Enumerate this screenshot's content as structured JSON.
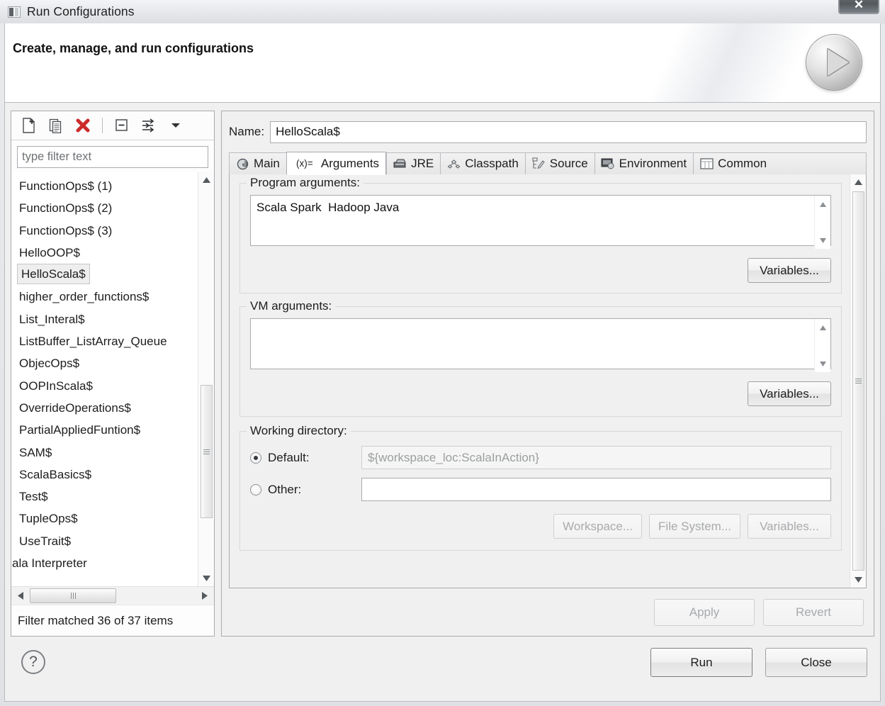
{
  "window": {
    "title": "Run Configurations",
    "icon": "run-configurations-icon",
    "close_label": "✕"
  },
  "header": {
    "title": "Create, manage, and run configurations",
    "run_icon": "play-circle-icon"
  },
  "left_panel": {
    "toolbar": [
      {
        "name": "new-configuration-icon",
        "tooltip": "New launch configuration"
      },
      {
        "name": "duplicate-configuration-icon",
        "tooltip": "Duplicate"
      },
      {
        "name": "delete-configuration-icon",
        "tooltip": "Delete"
      },
      {
        "name": "collapse-all-icon",
        "tooltip": "Collapse All"
      },
      {
        "name": "filter-icon",
        "tooltip": "Filter"
      },
      {
        "name": "chevron-down-icon",
        "tooltip": "View Menu"
      }
    ],
    "filter": {
      "placeholder": "type filter text",
      "value": ""
    },
    "items": [
      "FunctionOps$ (1)",
      "FunctionOps$ (2)",
      "FunctionOps$ (3)",
      "HelloOOP$",
      "HelloScala$",
      "higher_order_functions$",
      "List_Interal$",
      "ListBuffer_ListArray_Queue",
      "ObjecOps$",
      "OOPInScala$",
      "OverrideOperations$",
      "PartialAppliedFuntion$",
      "SAM$",
      "ScalaBasics$",
      "Test$",
      "TupleOps$",
      "UseTrait$",
      "ala Interpreter"
    ],
    "selected_item": "HelloScala$",
    "status": "Filter matched 36 of 37 items"
  },
  "right_panel": {
    "name_label": "Name:",
    "name_value": "HelloScala$",
    "tabs": [
      {
        "label": "Main",
        "icon": "main-circle-icon",
        "active": false
      },
      {
        "label": "Arguments",
        "icon": "arguments-xeq-icon",
        "active": true
      },
      {
        "label": "JRE",
        "icon": "jre-icon",
        "active": false
      },
      {
        "label": "Classpath",
        "icon": "classpath-icon",
        "active": false
      },
      {
        "label": "Source",
        "icon": "source-icon",
        "active": false
      },
      {
        "label": "Environment",
        "icon": "environment-icon",
        "active": false
      },
      {
        "label": "Common",
        "icon": "common-table-icon",
        "active": false
      }
    ],
    "program_arguments": {
      "label": "Program arguments:",
      "value": "Scala Spark  Hadoop Java",
      "variables_button": "Variables..."
    },
    "vm_arguments": {
      "label": "VM arguments:",
      "value": "",
      "variables_button": "Variables..."
    },
    "working_directory": {
      "label": "Working directory:",
      "default_label": "Default:",
      "default_value": "${workspace_loc:ScalaInAction}",
      "default_selected": true,
      "other_label": "Other:",
      "other_value": "",
      "other_selected": false,
      "workspace_button": "Workspace...",
      "filesystem_button": "File System...",
      "variables_button": "Variables..."
    },
    "apply_button": "Apply",
    "revert_button": "Revert"
  },
  "footer": {
    "help_icon": "help-question-icon",
    "run_button": "Run",
    "close_button": "Close"
  },
  "colors": {
    "window_bg": "#f0f0f0",
    "panel_bg": "#ffffff",
    "border": "#a8abaf",
    "text": "#1d1d1d",
    "disabled_text": "#a8aaad",
    "selection_bg": "#eeeeee",
    "delete_icon_red": "#cc2b2b"
  }
}
